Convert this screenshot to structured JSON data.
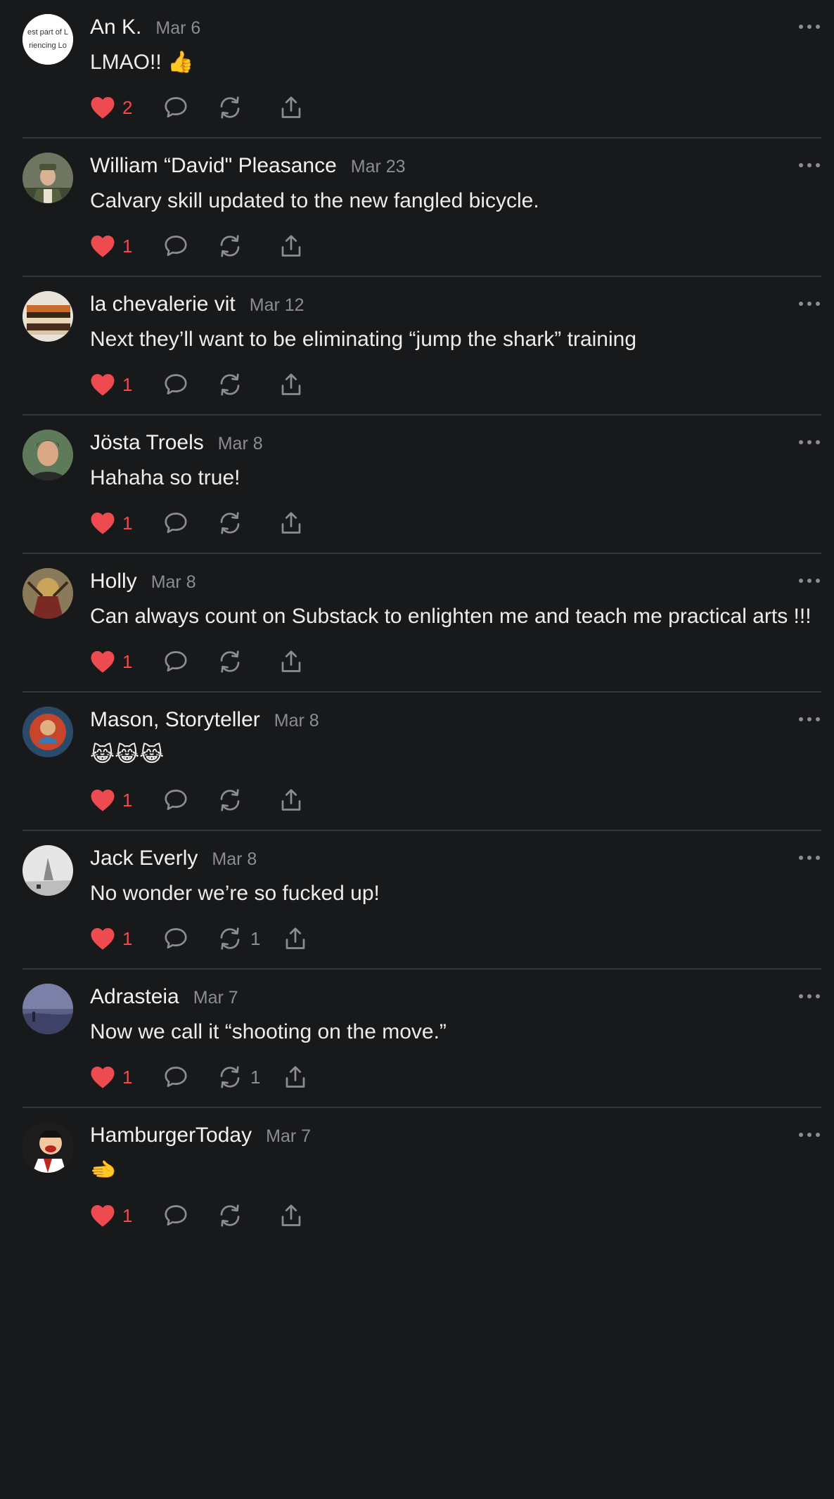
{
  "comments": [
    {
      "author": "An K.",
      "date": "Mar 6",
      "text": "LMAO!! 👍",
      "likes": "2",
      "restacks": "",
      "avatar_text_1": "est part of L",
      "avatar_text_2": "riencing Lo"
    },
    {
      "author": "William “David\" Pleasance",
      "date": "Mar 23",
      "text": "Calvary skill updated to the new fangled bicycle.",
      "likes": "1",
      "restacks": ""
    },
    {
      "author": "la chevalerie vit",
      "date": "Mar 12",
      "text": "Next they’ll want to be eliminating “jump the shark” training",
      "likes": "1",
      "restacks": ""
    },
    {
      "author": "Jösta Troels",
      "date": "Mar 8",
      "text": "Hahaha so true!",
      "likes": "1",
      "restacks": ""
    },
    {
      "author": "Holly",
      "date": "Mar 8",
      "text": "Can always count on Substack to enlighten me and teach me practical arts !!!",
      "likes": "1",
      "restacks": ""
    },
    {
      "author": "Mason, Storyteller",
      "date": "Mar 8",
      "text": "😹😹😹",
      "likes": "1",
      "restacks": ""
    },
    {
      "author": "Jack Everly",
      "date": "Mar 8",
      "text": "No wonder we’re so fucked up!",
      "likes": "1",
      "restacks": "1"
    },
    {
      "author": "Adrasteia",
      "date": "Mar 7",
      "text": "Now we call it “shooting on the move.”",
      "likes": "1",
      "restacks": "1"
    },
    {
      "author": "HamburgerToday",
      "date": "Mar 7",
      "text": "🫲",
      "likes": "1",
      "restacks": ""
    }
  ],
  "colors": {
    "background": "#18191b",
    "like_red": "#ee4b50",
    "muted_grey": "#8b8d91",
    "divider": "#34363a"
  },
  "icons": {
    "like": "heart-icon",
    "reply": "speech-bubble-icon",
    "restack": "restack-arrows-icon",
    "share": "share-upload-icon",
    "more": "ellipsis-icon"
  }
}
